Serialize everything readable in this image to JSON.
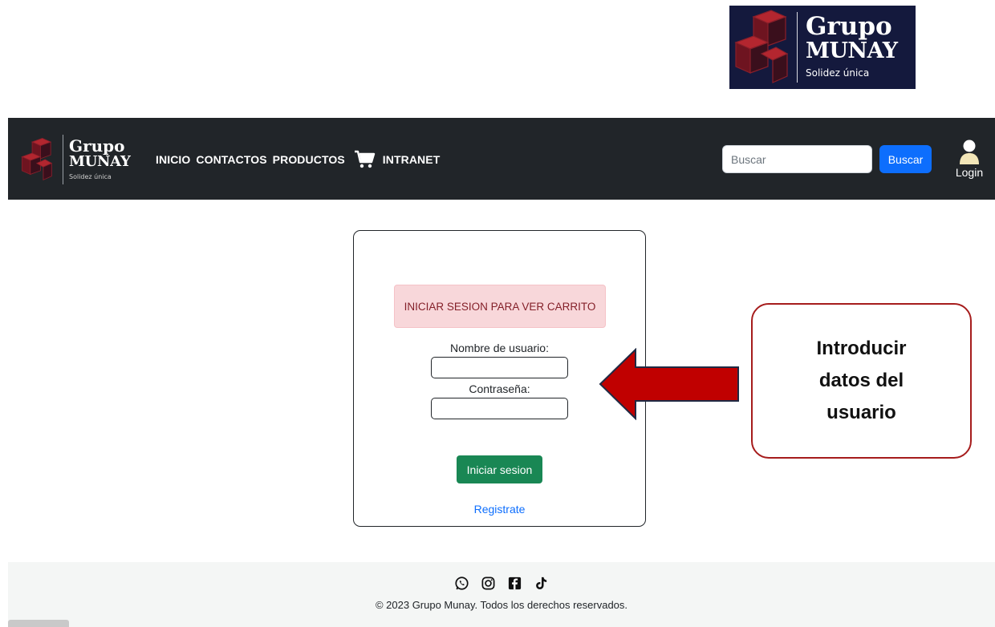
{
  "brand": {
    "name_line1": "Grupo",
    "name_line2": "MUNAY",
    "tagline": "Solidez única"
  },
  "nav": {
    "links": [
      "INICIO",
      "CONTACTOS",
      "PRODUCTOS",
      "INTRANET"
    ],
    "cart_icon": "cart-icon",
    "search_placeholder": "Buscar",
    "search_button": "Buscar",
    "login_label": "Login"
  },
  "login_card": {
    "alert": "INICIAR SESION PARA VER CARRITO",
    "username_label": "Nombre de usuario:",
    "password_label": "Contraseña:",
    "submit_label": "Iniciar sesion",
    "register_link": "Registrate"
  },
  "annotation": {
    "lines": [
      "Introducir",
      "datos del",
      "usuario"
    ]
  },
  "footer": {
    "social_icons": [
      "whatsapp-icon",
      "instagram-icon",
      "facebook-icon",
      "tiktok-icon"
    ],
    "copyright": "© 2023 Grupo Munay. Todos los derechos reservados."
  },
  "colors": {
    "navbar_bg": "#212529",
    "primary": "#0d6efd",
    "success": "#198754",
    "alert_bg": "#f8d7da",
    "alert_text": "#842029",
    "arrow": "#c00000",
    "logo_bg": "#14193d"
  }
}
